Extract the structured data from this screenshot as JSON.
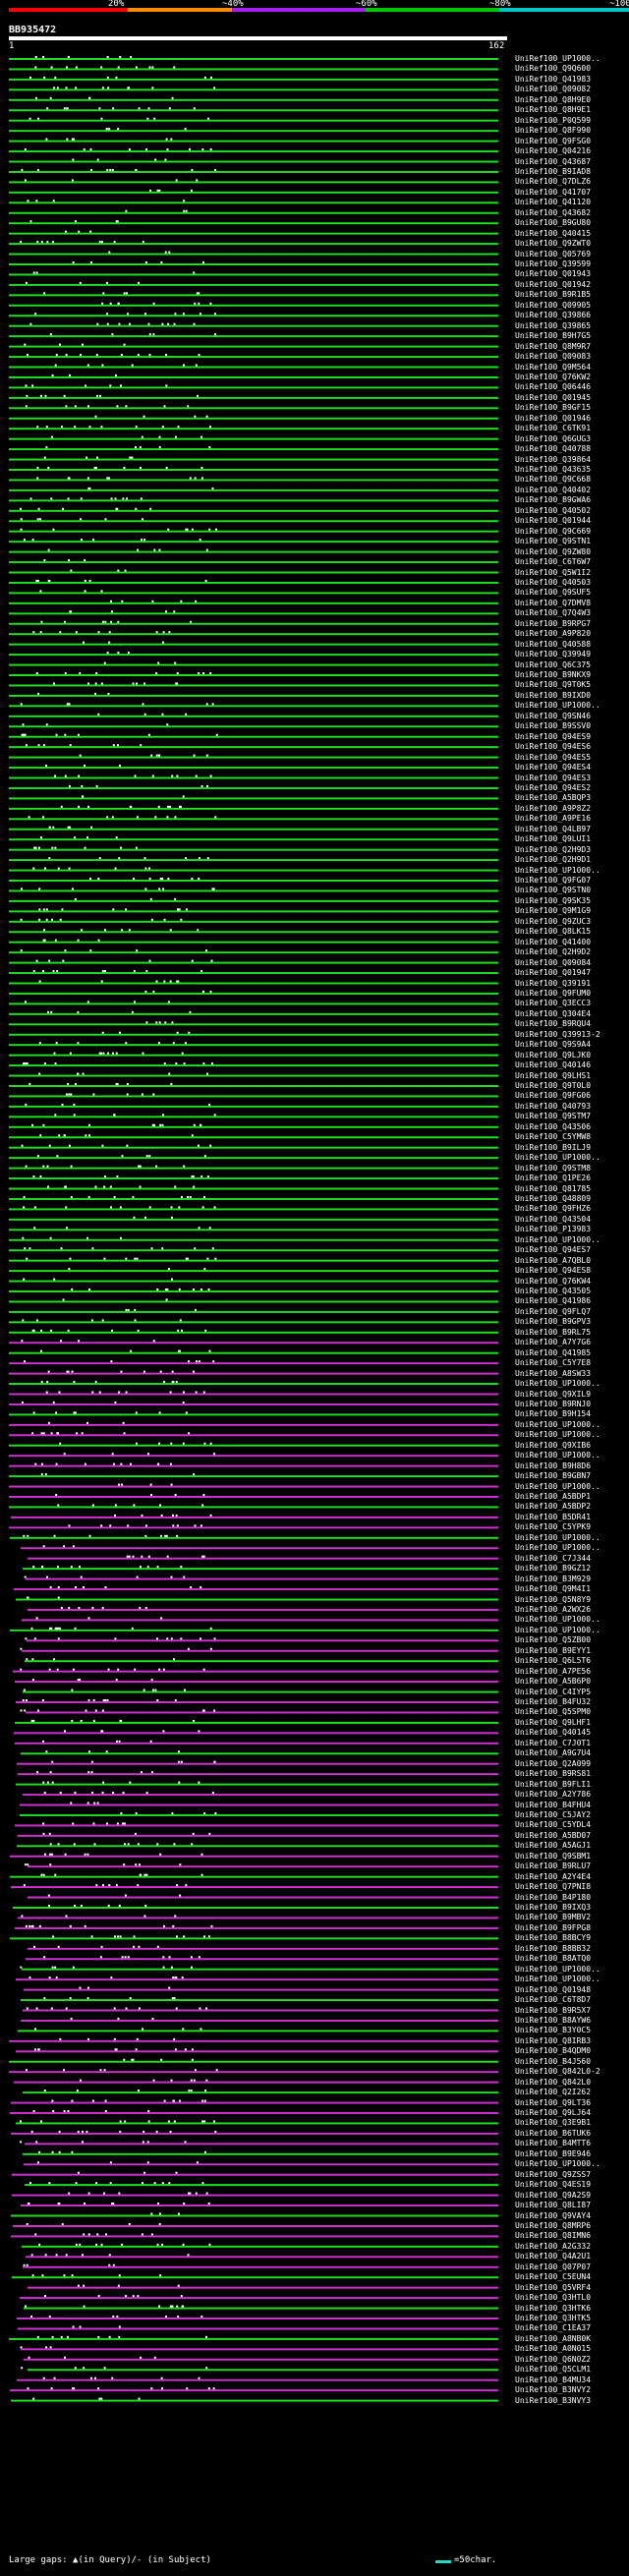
{
  "legend": {
    "marks": [
      {
        "label": "20%",
        "color": "#ff0000"
      },
      {
        "label": "~40%",
        "color": "#ff8c00"
      },
      {
        "label": "~60%",
        "color": "#a020f0"
      },
      {
        "label": "~80%",
        "color": "#00c800"
      },
      {
        "label": "~100%",
        "color": "#00c8c8"
      }
    ]
  },
  "query": {
    "id": "BB935472",
    "start": "1",
    "end": "162"
  },
  "colors": {
    "high": "#22dd22",
    "mid": "#cc33cc",
    "gap": "#ffffff"
  },
  "hits": [
    "UniRef100_UP1000..",
    "UniRef100_Q9Q600",
    "UniRef100_Q41983",
    "UniRef100_Q09082",
    "UniRef100_Q8H9E0",
    "UniRef100_Q8H9E1",
    "UniRef100_P0Q599",
    "UniRef100_Q8F990",
    "UniRef100_Q9FSG0",
    "UniRef100_Q04216",
    "UniRef100_Q43687",
    "UniRef100_B9IAD8",
    "UniRef100_Q7DLZ6",
    "UniRef100_Q41707",
    "UniRef100_Q41120",
    "UniRef100_Q43682",
    "UniRef100_B9GU80",
    "UniRef100_Q40415",
    "UniRef100_Q9ZWT0",
    "UniRef100_Q05769",
    "UniRef100_Q39599",
    "UniRef100_Q01943",
    "UniRef100_Q01942",
    "UniRef100_B9R1B5",
    "UniRef100_Q09905",
    "UniRef100_Q39866",
    "UniRef100_Q39865",
    "UniRef100_B9H7G5",
    "UniRef100_Q8M9R7",
    "UniRef100_Q09083",
    "UniRef100_Q9M564",
    "UniRef100_Q76KW2",
    "UniRef100_Q06446",
    "UniRef100_Q01945",
    "UniRef100_B9GF15",
    "UniRef100_Q01946",
    "UniRef100_C6TK91",
    "UniRef100_Q6GUG3",
    "UniRef100_Q40788",
    "UniRef100_Q39864",
    "UniRef100_Q43635",
    "UniRef100_Q9C668",
    "UniRef100_Q40402",
    "UniRef100_B9GWA6",
    "UniRef100_Q40502",
    "UniRef100_Q01944",
    "UniRef100_Q9C669",
    "UniRef100_Q9STN1",
    "UniRef100_Q9ZW80",
    "UniRef100_C6T6W7",
    "UniRef100_Q5W1I2",
    "UniRef100_Q40503",
    "UniRef100_Q9SUF5",
    "UniRef100_Q7DMV8",
    "UniRef100_Q7Q4W3",
    "UniRef100_B9RPG7",
    "UniRef100_A9P820",
    "UniRef100_Q40588",
    "UniRef100_Q39949",
    "UniRef100_Q6C375",
    "UniRef100_B9NKX9",
    "UniRef100_Q9T0K5",
    "UniRef100_B9IXD0",
    "UniRef100_UP1000..",
    "UniRef100_Q9SN46",
    "UniRef100_B9SSV0",
    "UniRef100_Q94ES9",
    "UniRef100_Q94ES6",
    "UniRef100_Q94ES5",
    "UniRef100_Q94ES4",
    "UniRef100_Q94ES3",
    "UniRef100_Q94ES2",
    "UniRef100_A5BQP3",
    "UniRef100_A9P8Z2",
    "UniRef100_A9PE16",
    "UniRef100_Q4LB97",
    "UniRef100_Q9LUI1",
    "UniRef100_Q2H9D3",
    "UniRef100_Q2H9D1",
    "UniRef100_UP1000..",
    "UniRef100_Q9FG07",
    "UniRef100_Q9STN0",
    "UniRef100_Q9SK35",
    "UniRef100_Q9M1G9",
    "UniRef100_Q9ZUC3",
    "UniRef100_Q8LK15",
    "UniRef100_Q41400",
    "UniRef100_Q2H9D2",
    "UniRef100_Q09084",
    "UniRef100_Q01947",
    "UniRef100_Q39191",
    "UniRef100_Q9FUM0",
    "UniRef100_Q3ECC3",
    "UniRef100_Q304E4",
    "UniRef100_B9RQU4",
    "UniRef100_Q39913-2",
    "UniRef100_Q9S9A4",
    "UniRef100_Q9LJK0",
    "UniRef100_Q40146",
    "UniRef100_Q9LHS1",
    "UniRef100_Q9T0L0",
    "UniRef100_Q9FG06",
    "UniRef100_Q40793",
    "UniRef100_Q9STM7",
    "UniRef100_Q43506",
    "UniRef100_C5YMW8",
    "UniRef100_B9ILJ9",
    "UniRef100_UP1000..",
    "UniRef100_Q9STM8",
    "UniRef100_Q1PE26",
    "UniRef100_Q81785",
    "UniRef100_Q48809",
    "UniRef100_Q9FHZ6",
    "UniRef100_Q43504",
    "UniRef100_P13983",
    "UniRef100_UP1000..",
    "UniRef100_Q94ES7",
    "UniRef100_A7QBL0",
    "UniRef100_Q94ES8",
    "UniRef100_Q76KW4",
    "UniRef100_Q43505",
    "UniRef100_Q41986",
    "UniRef100_Q9FLQ7",
    "UniRef100_B9GPV3",
    "UniRef100_B9RL75",
    "UniRef100_A7Y7G6",
    "UniRef100_Q41985",
    "UniRef100_C5Y7E8",
    "UniRef100_A8SW33",
    "UniRef100_UP1000..",
    "UniRef100_Q9XIL9",
    "UniRef100_B9RNJ0",
    "UniRef100_B9H154",
    "UniRef100_UP1000..",
    "UniRef100_UP1000..",
    "UniRef100_Q9XIB6",
    "UniRef100_UP1000..",
    "UniRef100_B9H8D6",
    "UniRef100_B9GBN7",
    "UniRef100_UP1000..",
    "UniRef100_A5BDP1",
    "UniRef100_A5BDP2",
    "UniRef100_B5DR41",
    "UniRef100_C5YPK9",
    "UniRef100_UP1000..",
    "UniRef100_UP1000..",
    "UniRef100_C7J344",
    "UniRef100_B9GZ12",
    "UniRef100_B3M929",
    "UniRef100_Q9M4I1",
    "UniRef100_Q5N8Y9",
    "UniRef100_A2WX26",
    "UniRef100_UP1000..",
    "UniRef100_UP1000..",
    "UniRef100_Q5ZB00",
    "UniRef100_B9EYY1",
    "UniRef100_Q6L5T6",
    "UniRef100_A7PE56",
    "UniRef100_A5B6P0",
    "UniRef100_C4IYP5",
    "UniRef100_B4FU32",
    "UniRef100_Q5SPM0",
    "UniRef100_Q9LHF1",
    "UniRef100_Q40145",
    "UniRef100_C7J0T1",
    "UniRef100_A9G7U4",
    "UniRef100_Q2A099",
    "UniRef100_B9RS81",
    "UniRef100_B9FLI1",
    "UniRef100_A2Y786",
    "UniRef100_B4FHU4",
    "UniRef100_C5JAY2",
    "UniRef100_C5YDL4",
    "UniRef100_A5BD07",
    "UniRef100_A5AGJ1",
    "UniRef100_Q9SBM1",
    "UniRef100_B9RLU7",
    "UniRef100_A2Y4E4",
    "UniRef100_Q7PNI8",
    "UniRef100_B4P180",
    "UniRef100_B9IXQ3",
    "UniRef100_B9MBV2",
    "UniRef100_B9FPG8",
    "UniRef100_B8BCY9",
    "UniRef100_B8BB32",
    "UniRef100_B8ATQ0",
    "UniRef100_UP1000..",
    "UniRef100_UP1000..",
    "UniRef100_Q01948",
    "UniRef100_C6T8D7",
    "UniRef100_B9R5X7",
    "UniRef100_B8AYW6",
    "UniRef100_B3Y0C5",
    "UniRef100_Q8IRB3",
    "UniRef100_B4QDM0",
    "UniRef100_B4J560",
    "UniRef100_Q842L0-2",
    "UniRef100_Q842L0",
    "UniRef100_Q2I262",
    "UniRef100_Q9LT36",
    "UniRef100_Q9LJ64",
    "UniRef100_Q3E9B1",
    "UniRef100_B6TUK6",
    "UniRef100_B4MTT6",
    "UniRef100_B9E946",
    "UniRef100_UP1000..",
    "UniRef100_Q9ZSS7",
    "UniRef100_Q4ES19",
    "UniRef100_Q9A2S9",
    "UniRef100_Q8LI87",
    "UniRef100_Q9VAY4",
    "UniRef100_Q8MRP6",
    "UniRef100_Q8IMN6",
    "UniRef100_A2G332",
    "UniRef100_Q4A2U1",
    "UniRef100_Q07P07",
    "UniRef100_C5EUN4",
    "UniRef100_Q5VRF4",
    "UniRef100_Q3HTL0",
    "UniRef100_Q3HTK6",
    "UniRef100_Q3HTK5",
    "UniRef100_C1EA37",
    "UniRef100_A8NB0K",
    "UniRef100_A0N015",
    "UniRef100_Q6N0Z2",
    "UniRef100_Q5CLM1",
    "UniRef100_B4MU34",
    "UniRef100_B3NVY2",
    "UniRef100_B3NVY3"
  ],
  "footer": {
    "gaps_text": "Large gaps: ▲(in Query)/- (in Subject)",
    "scale_text": "=50char."
  }
}
